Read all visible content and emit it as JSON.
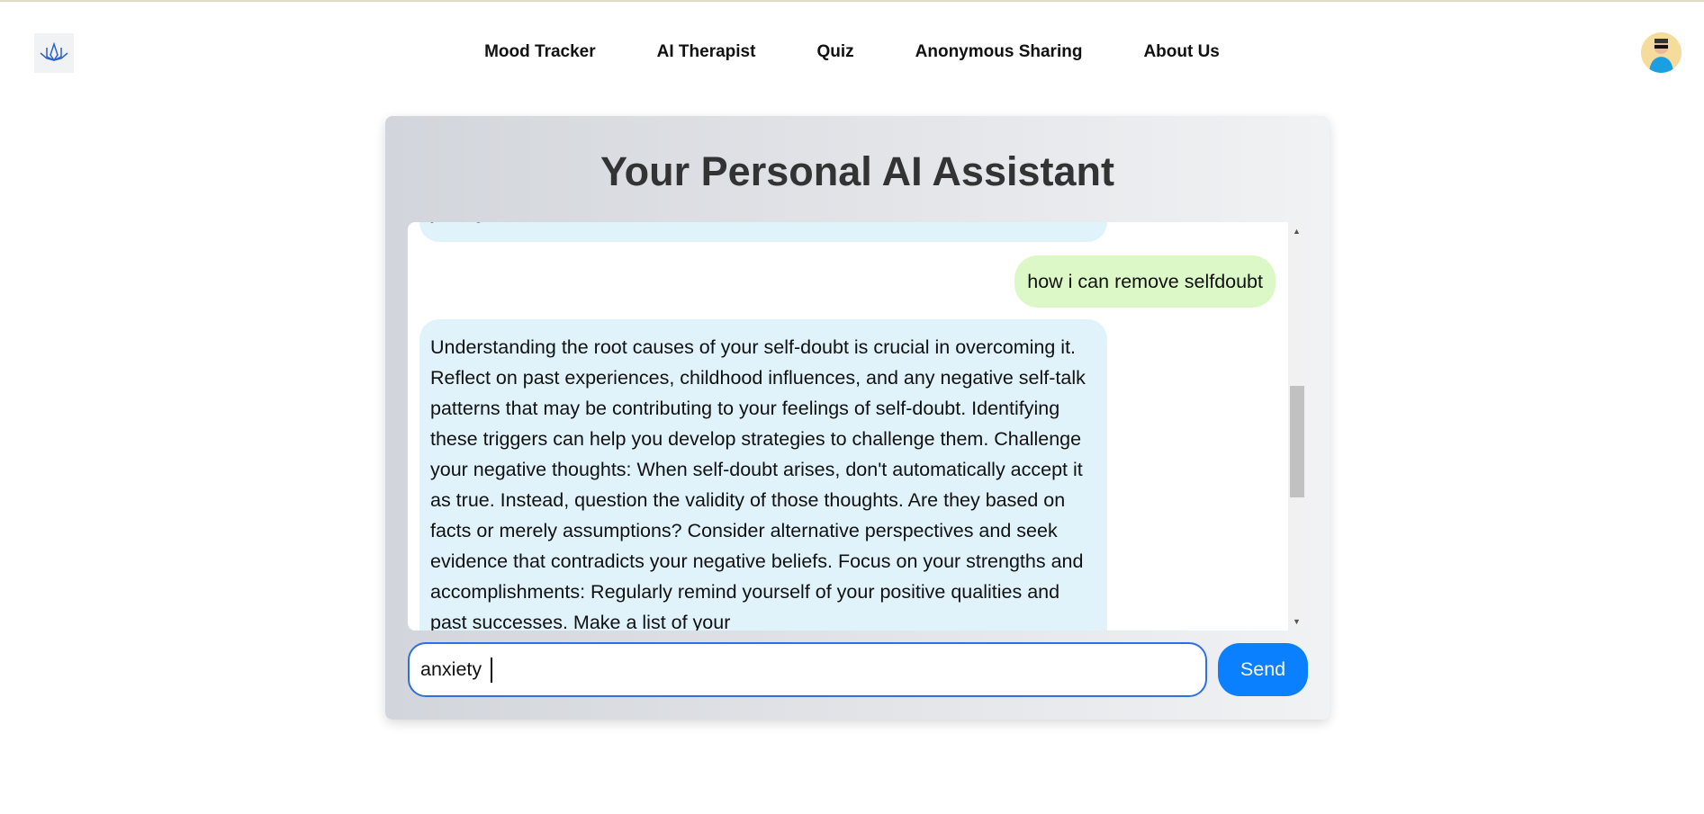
{
  "nav": {
    "items": [
      "Mood Tracker",
      "AI Therapist",
      "Quiz",
      "Anonymous Sharing",
      "About Us"
    ]
  },
  "card": {
    "title": "Your Personal AI Assistant"
  },
  "messages": [
    {
      "role": "bot",
      "text": "your goals."
    },
    {
      "role": "user",
      "text": "how i can remove selfdoubt"
    },
    {
      "role": "bot",
      "text": "Understanding the root causes of your self-doubt is crucial in overcoming it. Reflect on past experiences, childhood influences, and any negative self-talk patterns that may be contributing to your feelings of self-doubt. Identifying these triggers can help you develop strategies to challenge them. Challenge your negative thoughts: When self-doubt arises, don't automatically accept it as true. Instead, question the validity of those thoughts. Are they based on facts or merely assumptions? Consider alternative perspectives and seek evidence that contradicts your negative beliefs. Focus on your strengths and accomplishments: Regularly remind yourself of your positive qualities and past successes. Make a list of your"
    }
  ],
  "input": {
    "value": "anxiety "
  },
  "send_label": "Send"
}
